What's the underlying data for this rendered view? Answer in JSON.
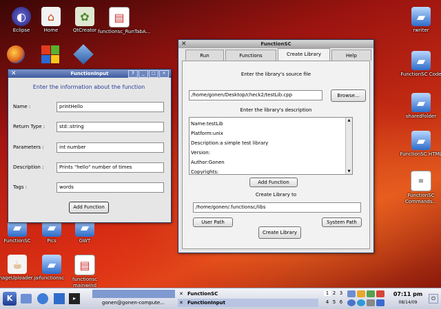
{
  "desktop": {
    "icons_top": [
      {
        "label": "Eclipse"
      },
      {
        "label": "Home"
      },
      {
        "label": "QtCreator"
      },
      {
        "label": "functionsc_RunTabA..."
      }
    ],
    "icons_right": [
      {
        "label": "rwriter"
      },
      {
        "label": "FunctionSC Code"
      },
      {
        "label": "sharedfolder"
      },
      {
        "label": "FunctionSC HTML"
      },
      {
        "label": "FunctionSC Commands..."
      }
    ],
    "icons_bottom": [
      {
        "label": "FunctionSC"
      },
      {
        "label": "Pics"
      },
      {
        "label": "GWT"
      },
      {
        "label": "ImageUploader.jar"
      },
      {
        "label": "functionsc"
      },
      {
        "label": "functionsc mainwind"
      }
    ]
  },
  "function_input": {
    "title": "FunctionInput",
    "heading": "Enter the information about the function",
    "name_label": "Name :",
    "name_value": "printHello",
    "return_label": "Return Type :",
    "return_value": "std::string",
    "params_label": "Parameters :",
    "params_value": "int number",
    "desc_label": "Description :",
    "desc_value": "Prints \"hello\" number of times",
    "tags_label": "Tags :",
    "tags_value": "words",
    "add_button": "Add Function"
  },
  "function_sc": {
    "title": "FunctionSC",
    "tabs": [
      {
        "label": "Run"
      },
      {
        "label": "Functions"
      },
      {
        "label": "Create Library"
      },
      {
        "label": "Help"
      }
    ],
    "source_prompt": "Enter the library's source file",
    "source_path": "/home/gonen/Desktop/check2/testLib.cpp",
    "browse_button": "Browse...",
    "desc_prompt": "Enter the library's description",
    "desc_lines": [
      "Name:testLib",
      "Platform:unix",
      "Description:a simple test library",
      "Version:",
      "Author:Gonen",
      "Copyrights:"
    ],
    "add_button": "Add Function",
    "create_prompt": "Create Library to",
    "lib_path": "/home/gonen/.functionsc/libs",
    "user_path_button": "User Path",
    "system_path_button": "System Path",
    "create_button": "Create Library"
  },
  "taskbar": {
    "task1": "FunctionSC",
    "task2": "FunctionInput",
    "task3": "gonen@gonen-compute...",
    "pager_top": [
      "1",
      "2",
      "3"
    ],
    "pager_bottom": [
      "4",
      "5",
      "6"
    ],
    "clock": "07:11 pm",
    "date": "08/14/09"
  },
  "colors": {
    "heading_blue": "#2a3c9a",
    "title_active": "#3e5a9e"
  }
}
